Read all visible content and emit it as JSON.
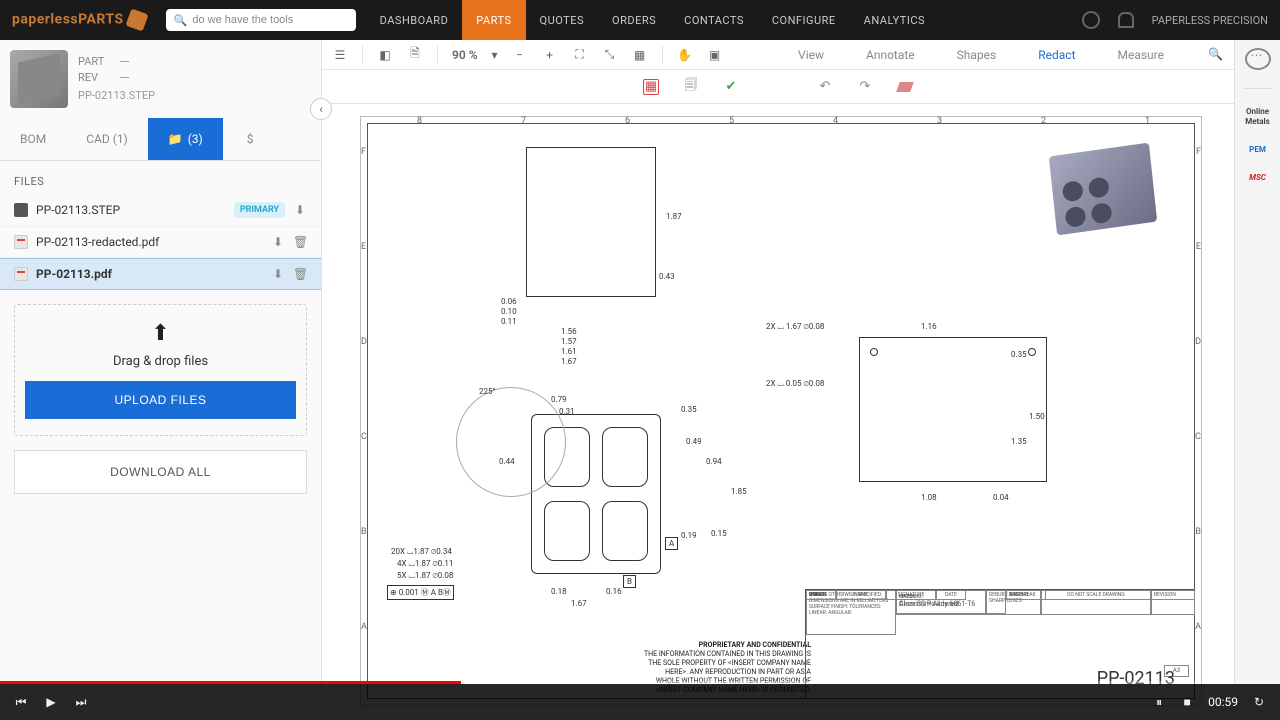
{
  "brand": "paperlessPARTS",
  "search": {
    "value": "do we have the tools"
  },
  "nav": {
    "dashboard": "DASHBOARD",
    "parts": "PARTS",
    "quotes": "QUOTES",
    "orders": "ORDERS",
    "contacts": "CONTACTS",
    "configure": "CONFIGURE",
    "analytics": "ANALYTICS"
  },
  "tenant": "PAPERLESS PRECISION",
  "part": {
    "part_label": "PART",
    "part_value": "---",
    "rev_label": "REV",
    "rev_value": "---",
    "filename": "PP-02113.STEP"
  },
  "side_tabs": {
    "bom": "BOM",
    "cad": "CAD (1)",
    "files": "(3)",
    "dollar": "$"
  },
  "files_heading": "FILES",
  "files": [
    {
      "name": "PP-02113.STEP",
      "primary_badge": "PRIMARY"
    },
    {
      "name": "PP-02113-redacted.pdf"
    },
    {
      "name": "PP-02113.pdf"
    }
  ],
  "dropzone": {
    "text": "Drag & drop files",
    "upload_btn": "UPLOAD FILES"
  },
  "download_all": "DOWNLOAD ALL",
  "viewer_toolbar": {
    "zoom": "90 %",
    "tabs": {
      "view": "View",
      "annotate": "Annotate",
      "shapes": "Shapes",
      "redact": "Redact",
      "measure": "Measure"
    }
  },
  "drawing": {
    "zones_top": [
      "8",
      "7",
      "6",
      "5",
      "4",
      "3",
      "2",
      "1"
    ],
    "zones_side": [
      "F",
      "E",
      "D",
      "C",
      "B",
      "A"
    ],
    "dims": {
      "d1": "1.87",
      "d2": "0.43",
      "d3": "0.06",
      "d4": "0.10",
      "d5": "0.11",
      "d6": "1.56",
      "d7": "1.57",
      "d8": "1.61",
      "d9": "1.67",
      "d10": "225°",
      "d11": "0.79",
      "d12": "0.31",
      "d13": "0.35",
      "d14": "0.49",
      "d15": "0.94",
      "d16": "1.85",
      "d17": "0.44",
      "d18": "0.19",
      "d19": "0.15",
      "d20": "0.18",
      "d21": "0.16",
      "d22": "1.67",
      "d23": "2X ⌴ 1.67 ⌀0.08",
      "d24": "2X ⌴ 0.05 ⌀0.08",
      "d25": "1.16",
      "d26": "0.35",
      "d27": "1.50",
      "d28": "1.35",
      "d29": "1.08",
      "d30": "0.04",
      "n1": "20X ⌴1.87 ⌀0.34",
      "n2": "4X ⌴1.87 ⌀0.11",
      "n3": "5X ⌴1.87 ⌀0.08",
      "fcf": "⊕ 0.001 Ⓜ A BⓂ",
      "datumA": "A",
      "datumB": "B"
    },
    "title_block": {
      "prop_head": "PROPRIETARY AND CONFIDENTIAL",
      "prop_body": "THE INFORMATION CONTAINED IN THIS DRAWING IS THE SOLE PROPERTY OF <INSERT COMPANY NAME HERE>. ANY REPRODUCTION IN PART OR AS A WHOLE WITHOUT THE WRITTEN PERMISSION OF <INSERT COMPANY NAME HERE> IS PROHIBITED.",
      "finish": "Clear SS Powdered",
      "material": "Aluminum Alloy 6061-T6",
      "tol_head": "UNLESS OTHERWISE SPECIFIED: DIMENSIONS ARE IN MILLIMETERS SURFACE FINISH: TOLERANCES: LINEAR: ANGULAR:",
      "name": "NAME",
      "signature": "SIGNATURE",
      "date": "DATE",
      "drawn": "DRAWN",
      "chkd": "CHK'D",
      "appvd": "APPV'D",
      "mfg": "MFG",
      "qa": "Q.A",
      "title": "TITLE:",
      "material_label": "MATERIAL:",
      "dwg_no": "DWG NO.",
      "deburr": "DEBURR AND BREAK SHARP EDGES",
      "scale": "DO NOT SCALE DRAWING",
      "revision": "REVISION",
      "sheet": "A3",
      "number": "PP-02113",
      "finish_label": "FINISH:"
    }
  },
  "vendors": {
    "om": "Online Metals",
    "pem": "PEM",
    "msc": "MSC"
  },
  "video": {
    "time": "00:59"
  }
}
